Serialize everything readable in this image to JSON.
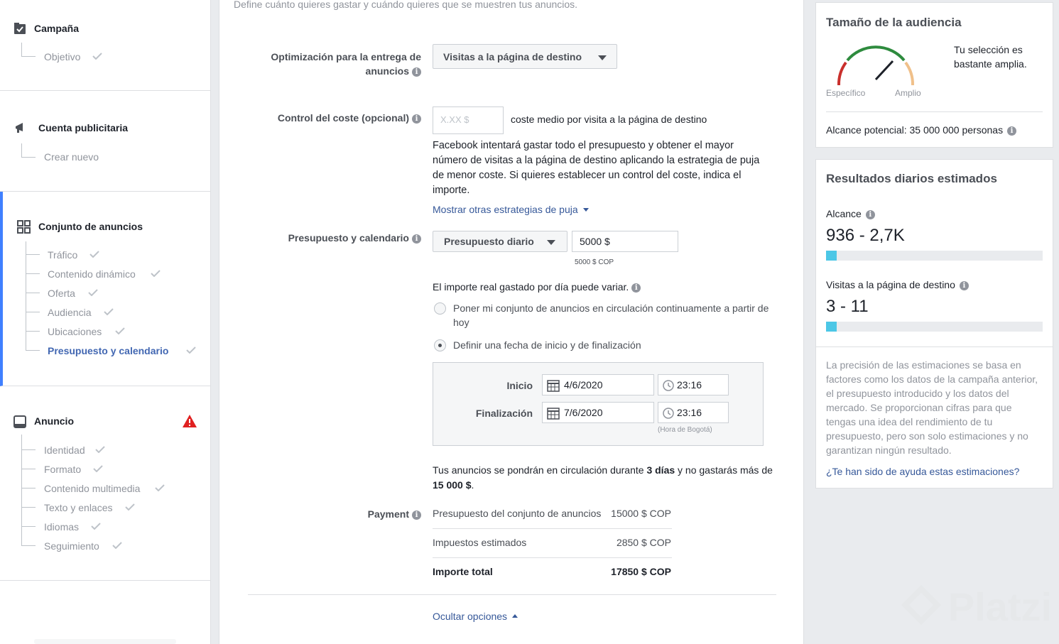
{
  "sidebar": {
    "campaign": {
      "title": "Campaña",
      "items": [
        "Objetivo"
      ]
    },
    "account": {
      "title": "Cuenta publicitaria",
      "items": [
        "Crear nuevo"
      ]
    },
    "adset": {
      "title": "Conjunto de anuncios",
      "items": [
        "Tráfico",
        "Contenido dinámico",
        "Oferta",
        "Audiencia",
        "Ubicaciones",
        "Presupuesto y calendario"
      ]
    },
    "ad": {
      "title": "Anuncio",
      "items": [
        "Identidad",
        "Formato",
        "Contenido multimedia",
        "Texto y enlaces",
        "Idiomas",
        "Seguimiento"
      ]
    }
  },
  "main": {
    "intro": "Define cuánto quieres gastar y cuándo quieres que se muestren tus anuncios.",
    "optimization": {
      "label": "Optimización para la entrega de anuncios",
      "value": "Visitas a la página de destino"
    },
    "cost_control": {
      "label": "Control del coste (opcional)",
      "placeholder": "X.XX $",
      "suffix": "coste medio por visita a la página de destino",
      "description": "Facebook intentará gastar todo el presupuesto y obtener el mayor número de visitas a la página de destino aplicando la estrategia de puja de menor coste. Si quieres establecer un control del coste, indica el importe.",
      "more_link": "Mostrar otras estrategias de puja"
    },
    "budget": {
      "label": "Presupuesto y calendario",
      "type": "Presupuesto diario",
      "amount": "5000 $",
      "amount_note": "5000 $ COP",
      "variance_note": "El importe real gastado por día puede variar.",
      "radio_continuous": "Poner mi conjunto de anuncios en circulación continuamente a partir de hoy",
      "radio_dates": "Definir una fecha de inicio y de finalización",
      "start_label": "Inicio",
      "start_date": "4/6/2020",
      "start_time": "23:16",
      "end_label": "Finalización",
      "end_date": "7/6/2020",
      "end_time": "23:16",
      "timezone": "(Hora de Bogotá)",
      "summary_pre": "Tus anuncios se pondrán en circulación durante ",
      "summary_days": "3 días",
      "summary_mid": " y no gastarás más de ",
      "summary_amount": "15 000 $",
      "summary_end": "."
    },
    "payment": {
      "label": "Payment",
      "rows": [
        {
          "name": "Presupuesto del conjunto de anuncios",
          "value": "15000 $ COP"
        },
        {
          "name": "Impuestos estimados",
          "value": "2850 $ COP"
        },
        {
          "name": "Importe total",
          "value": "17850 $ COP"
        }
      ]
    },
    "hide_options": "Ocultar opciones"
  },
  "audience": {
    "title": "Tamaño de la audiencia",
    "gauge_specific": "Específico",
    "gauge_broad": "Amplio",
    "gauge_level": 0.75,
    "status": "Tu selección es bastante amplia.",
    "potential_reach": "Alcance potencial: 35 000 000 personas"
  },
  "results": {
    "title": "Resultados diarios estimados",
    "reach_label": "Alcance",
    "reach_value": "936 - 2,7K",
    "reach_fill": 0.05,
    "visits_label": "Visitas a la página de destino",
    "visits_value": "3 - 11",
    "visits_fill": 0.05,
    "disclaimer": "La precisión de las estimaciones se basa en factores como los datos de la campaña anterior, el presupuesto introducido y los datos del mercado. Se proporcionan cifras para que tengas una idea del rendimiento de tu presupuesto, pero son solo estimaciones y no garantizan ningún resultado.",
    "feedback_link": "¿Te han sido de ayuda estas estimaciones?"
  },
  "watermark": "Platzi",
  "colors": {
    "accent": "#4080ff",
    "link": "#365899",
    "bar_fill": "#4cc7e6",
    "warning": "#e02020"
  }
}
